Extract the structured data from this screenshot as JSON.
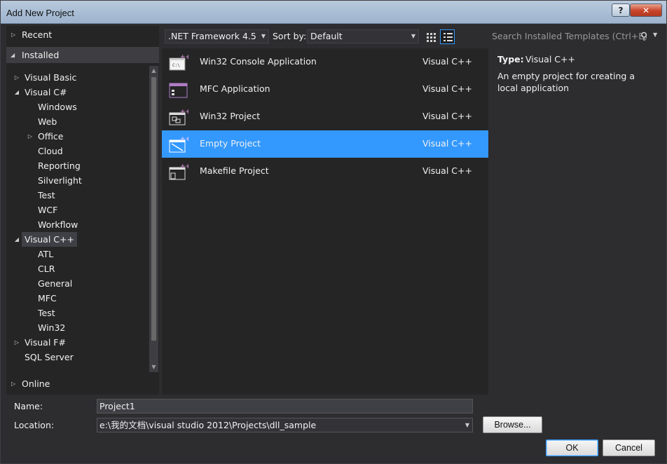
{
  "window": {
    "title": "Add New Project",
    "help_label": "?",
    "close_label": "✕"
  },
  "tree": {
    "recent": "Recent",
    "installed": "Installed",
    "online": "Online",
    "items": [
      {
        "label": "Visual Basic",
        "indent": 1,
        "arrow": "▷"
      },
      {
        "label": "Visual C#",
        "indent": 1,
        "arrow": "◢"
      },
      {
        "label": "Windows",
        "indent": 2,
        "arrow": ""
      },
      {
        "label": "Web",
        "indent": 2,
        "arrow": ""
      },
      {
        "label": "Office",
        "indent": 2,
        "arrow": "▷"
      },
      {
        "label": "Cloud",
        "indent": 2,
        "arrow": ""
      },
      {
        "label": "Reporting",
        "indent": 2,
        "arrow": ""
      },
      {
        "label": "Silverlight",
        "indent": 2,
        "arrow": ""
      },
      {
        "label": "Test",
        "indent": 2,
        "arrow": ""
      },
      {
        "label": "WCF",
        "indent": 2,
        "arrow": ""
      },
      {
        "label": "Workflow",
        "indent": 2,
        "arrow": ""
      },
      {
        "label": "Visual C++",
        "indent": 1,
        "arrow": "◢"
      },
      {
        "label": "ATL",
        "indent": 2,
        "arrow": ""
      },
      {
        "label": "CLR",
        "indent": 2,
        "arrow": ""
      },
      {
        "label": "General",
        "indent": 2,
        "arrow": ""
      },
      {
        "label": "MFC",
        "indent": 2,
        "arrow": ""
      },
      {
        "label": "Test",
        "indent": 2,
        "arrow": ""
      },
      {
        "label": "Win32",
        "indent": 2,
        "arrow": ""
      },
      {
        "label": "Visual F#",
        "indent": 1,
        "arrow": "▷"
      },
      {
        "label": "SQL Server",
        "indent": 1,
        "arrow": ""
      }
    ]
  },
  "toolbar": {
    "framework": ".NET Framework 4.5",
    "sort_label": "Sort by:",
    "sort_value": "Default",
    "search_placeholder": "Search Installed Templates (Ctrl+E)"
  },
  "templates": [
    {
      "name": "Win32 Console Application",
      "lang": "Visual C++",
      "icon": "console-app-icon",
      "selected": false
    },
    {
      "name": "MFC Application",
      "lang": "Visual C++",
      "icon": "mfc-app-icon",
      "selected": false
    },
    {
      "name": "Win32 Project",
      "lang": "Visual C++",
      "icon": "win32-project-icon",
      "selected": false
    },
    {
      "name": "Empty Project",
      "lang": "Visual C++",
      "icon": "empty-project-icon",
      "selected": true
    },
    {
      "name": "Makefile Project",
      "lang": "Visual C++",
      "icon": "makefile-project-icon",
      "selected": false
    }
  ],
  "detail": {
    "type_label": "Type:",
    "type_value": "Visual C++",
    "description": "An empty project for creating a local application"
  },
  "form": {
    "name_label": "Name:",
    "name_value": "Project1",
    "location_label": "Location:",
    "location_value": "e:\\我的文档\\visual studio 2012\\Projects\\dll_sample",
    "browse_label": "Browse...",
    "ok_label": "OK",
    "cancel_label": "Cancel"
  },
  "colors": {
    "accent": "#3399ff",
    "panel": "#252526",
    "background": "#2d2d30"
  }
}
